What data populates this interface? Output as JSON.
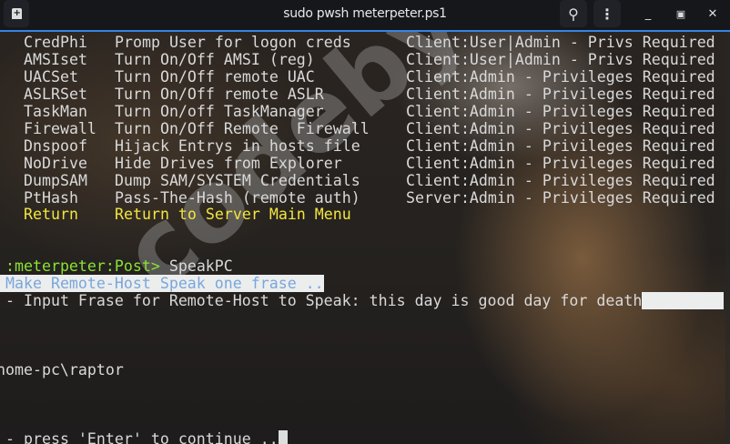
{
  "window": {
    "title": "sudo pwsh meterpeter.ps1"
  },
  "modules": [
    {
      "name": "CredPhi",
      "desc": "Promp User for logon creds",
      "req": "Client:User|Admin - Privs Required"
    },
    {
      "name": "AMSIset",
      "desc": "Turn On/Off AMSI (reg)",
      "req": "Client:User|Admin - Privs Required"
    },
    {
      "name": "UACSet",
      "desc": "Turn On/Off remote UAC",
      "req": "Client:Admin - Privileges Required"
    },
    {
      "name": "ASLRSet",
      "desc": "Turn On/Off remote ASLR",
      "req": "Client:Admin - Privileges Required"
    },
    {
      "name": "TaskMan",
      "desc": "Turn On/off TaskManager",
      "req": "Client:Admin - Privileges Required"
    },
    {
      "name": "Firewall",
      "desc": "Turn On/Off Remote  Firewall",
      "req": "Client:Admin - Privileges Required"
    },
    {
      "name": "Dnspoof",
      "desc": "Hijack Entrys in hosts file",
      "req": "Client:Admin - Privileges Required"
    },
    {
      "name": "NoDrive",
      "desc": "Hide Drives from Explorer",
      "req": "Client:Admin - Privileges Required"
    },
    {
      "name": "DumpSAM",
      "desc": "Dump SAM/SYSTEM Credentials",
      "req": "Client:Admin - Privileges Required"
    },
    {
      "name": "PtHash",
      "desc": "Pass-The-Hash (remote auth)",
      "req": "Server:Admin - Privileges Required"
    }
  ],
  "return_item": {
    "name": "Return",
    "desc": "Return to Server Main Menu"
  },
  "prompt": ":meterpeter:Post>",
  "command": "SpeakPC",
  "banner": "Make Remote-Host Speak one frase ..",
  "input_line": "- Input Frase for Remote-Host to Speak: this day is good day for death",
  "path_line": "home-pc\\raptor",
  "continue_line": "- press 'Enter' to continue ..",
  "watermark": "codeby"
}
